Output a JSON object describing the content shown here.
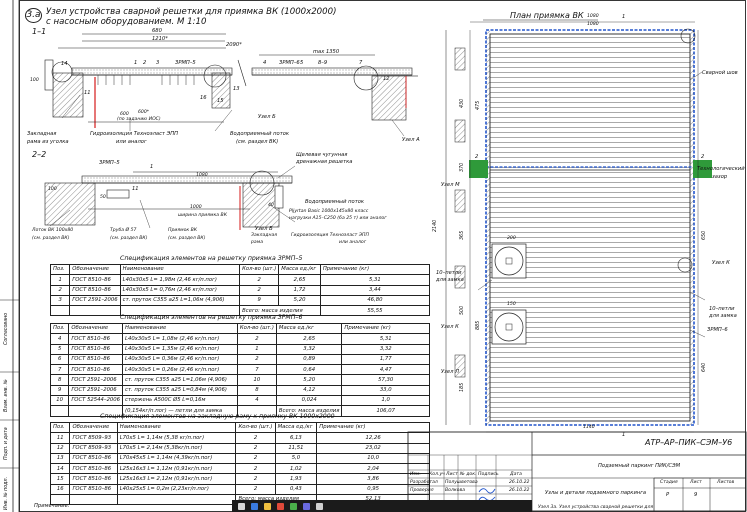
{
  "section_a": {
    "mark": "3.a",
    "title_line1": "Узел устройства сварной решетки для приямка ВК (1000х2000)",
    "title_line2": "с насосным оборудованием. М 1:10",
    "cut_1": "1–1",
    "cut_2": "2–2",
    "dims": {
      "d680": "680",
      "d2090": "2090*",
      "d1210": "1210*",
      "dmax": "max 1350",
      "d600": "600*",
      "d600b": "600",
      "d1080": "1080",
      "d1000": "1000",
      "d100a": "100",
      "d100b": "100",
      "d50": "50",
      "d40": "40"
    },
    "tags": {
      "zrmp5": "ЗРМП–5",
      "zrmp6": "ЗРМП–6",
      "t89": "8–9",
      "t14": "14",
      "t1": "1",
      "t2": "2",
      "t3": "3",
      "t4": "4",
      "t5": "5",
      "t7": "7",
      "t11": "11",
      "t12": "12",
      "t13": "13",
      "t15": "15",
      "t16": "16"
    },
    "callouts": {
      "zaklad": "Закладная",
      "rama_ugolka": "рама из уголка",
      "gidro1": "Гидроизоляция Техноэласт ЭПП",
      "po_vk1": "или аналог",
      "vodopr": "Водоприемный поток",
      "razdel": "(см. раздел ВК)",
      "uzel_b": "Узел Б",
      "uzel_a": "Узел А",
      "po_zadaniyu": "(по заданию ИОС)",
      "shchel": "Щелевая чугунная",
      "shchel2": "дренажная решетка",
      "vodopr2": "Водоприемный поток",
      "pljt1": "Pljyrtan Basic 1000х145х80 класс",
      "pljt2": "нагрузки A15–C250 (6а 25 т) или аналог",
      "lotok": "Лоток ВК 100х80",
      "lotok_r": "(см. раздел ВК)",
      "truba": "Труба Ø 57",
      "truba_r": "(см. раздел ВК)",
      "priyamok": "Приямок ВК",
      "priyamok_r": "(см. раздел ВК)",
      "shirina": "ширина приямка ВК",
      "zaklad_rama": "Закладная",
      "rama": "рама",
      "gidro2": "Гидроизоляция Техноэласт ЭПП",
      "ili": "или аналог",
      "uzel_b2": "Узел Б"
    }
  },
  "plan": {
    "title": "План приямка ВК",
    "d1080": "1080",
    "d1140": "1140",
    "d2140": "2140",
    "side_dims": [
      "430",
      "370",
      "365",
      "500",
      "185",
      "475",
      "885",
      "650",
      "640"
    ],
    "labels": {
      "svarn": "Сварной шов",
      "tech1": "Технологический",
      "tech2": "зазор",
      "uzel_k": "Узел К",
      "uzel_l": "Узел Л",
      "uzel_m": "Узел М",
      "petli1": "10–петли",
      "petli2": "для замка",
      "petli3": "10–петли",
      "petli4": "для замка",
      "zrmp6": "ЗРМП–6",
      "m1": "1",
      "m2": "2",
      "m22": "2",
      "d200": "200",
      "d150": "150"
    }
  },
  "spec5": {
    "title": "Спецификация элементов на решетку приямка ЗРМП–5",
    "headers": [
      "Поз.",
      "Обозначение",
      "Наименование",
      "Кол-во (шт.)",
      "Масса ед./кг",
      "Примечание (кг)"
    ],
    "rows": [
      [
        "1",
        "ГОСТ 8510–86",
        "L40х30х5  L= 1,98м (2,46 кг/п.пог)",
        "2",
        "2,65",
        "5,31"
      ],
      [
        "2",
        "ГОСТ 8510–86",
        "L40х30х5  L= 0,76м (2,46 кг/п.пог)",
        "2",
        "1,72",
        "3,44"
      ],
      [
        "3",
        "ГОСТ 2591–2006",
        "ст. пруток С355 а25 L=1,06м (4,906)",
        "9",
        "5,20",
        "46,80"
      ]
    ],
    "total": "Всего: масса изделия",
    "total_val": "55,55"
  },
  "spec6": {
    "title": "Спецификация элементов на решетку приямка ЗРМП–6",
    "headers": [
      "Поз.",
      "Обозначение",
      "Наименование",
      "Кол-во (шт.)",
      "Масса ед./кг",
      "Примечание (кг)"
    ],
    "rows": [
      [
        "4",
        "ГОСТ 8510–86",
        "L40х30х5  L= 1,08м (2,46 кг/п.пог)",
        "2",
        "2,65",
        "5,31"
      ],
      [
        "5",
        "ГОСТ 8510–86",
        "L40х30х5  L= 1,35м (2,46 кг/п.пог)",
        "1",
        "3,32",
        "3,32"
      ],
      [
        "6",
        "ГОСТ 8510–86",
        "L40х30х5  L= 0,36м (2,46 кг/п.пог)",
        "2",
        "0,89",
        "1,77"
      ],
      [
        "7",
        "ГОСТ 8510–86",
        "L40х30х5  L= 0,26м (2,46 кг/п.пог)",
        "7",
        "0,64",
        "4,47"
      ],
      [
        "8",
        "ГОСТ 2591–2006",
        "ст. пруток С355 а25 L=1,06м (4,906)",
        "10",
        "5,20",
        "57,30"
      ],
      [
        "9",
        "ГОСТ 2591–2006",
        "ст. пруток С355 а25 L=0,84м (4,906)",
        "8",
        "4,12",
        "33,0"
      ],
      [
        "10",
        "ГОСТ 52544–2006",
        "стержень А500С Ø5 L=0,16м",
        "4",
        "0,024",
        "1,0"
      ],
      [
        "",
        "",
        "(0,154кг/п.пог) — петли для замка",
        "",
        "Всего: масса изделия",
        "106,07"
      ]
    ]
  },
  "spec_zakl": {
    "title": "Спецификация элементов на закладную раму к приямку ВК 1000х2000",
    "headers": [
      "Поз.",
      "Обозначение",
      "Наименование",
      "Кол-во (шт.)",
      "Масса ед./кг",
      "Примечание (кг)"
    ],
    "rows": [
      [
        "11",
        "ГОСТ 8509–93",
        "L70х5  L= 1,14м (5,38 кг/п.пог)",
        "2",
        "6,13",
        "12,26"
      ],
      [
        "12",
        "ГОСТ 8509–93",
        "L70х5  L= 2,14м (5,38кг/п.пог)",
        "2",
        "11,51",
        "23,02"
      ],
      [
        "13",
        "ГОСТ 8510–86",
        "L70х45х5  L= 1,14м (4,39кг/п.пог)",
        "2",
        "5,0",
        "10,0"
      ],
      [
        "14",
        "ГОСТ 8510–86",
        "L25х16х3  L= 1,12м (0,91кг/п.пог)",
        "2",
        "1,02",
        "2,04"
      ],
      [
        "15",
        "ГОСТ 8510–86",
        "L25х16х3  L= 2,12м (0,91кг/п.пог)",
        "2",
        "1,93",
        "3,86"
      ],
      [
        "16",
        "ГОСТ 8510–86",
        "L40х25х5  L= 0,2м (2,23кг/п.пог)",
        "2",
        "0,43",
        "0,95"
      ]
    ],
    "total": "Всего: масса изделия",
    "total_val": "52,13",
    "note": "Примечание:"
  },
  "side_stamp": {
    "a": "Согласовано",
    "b": "Взам. инв. №",
    "c": "Подп. и дата",
    "d": "Инв. № подл."
  },
  "title_block": {
    "code": "АТР–АР–ПИК–СЭМ–У6",
    "project": "Подземный паркинг ПИК/СЭМ",
    "sheet_name": "Узлы и детали подземного паркинга",
    "cols": [
      "Изм.",
      "Кол.уч",
      "Лист",
      "№ док.",
      "Подпись",
      "Дата"
    ],
    "r1": [
      "Разработал",
      "Полушветова",
      "",
      "26.10.22"
    ],
    "r2": [
      "Проверил",
      "Волкова",
      "",
      "26.10.22"
    ],
    "stage_h": [
      "Стадия",
      "Лист",
      "Листов"
    ],
    "stage_v": [
      "Р",
      "9",
      ""
    ],
    "node_title": "Узел 3а. Узел устройства сварной решетки для"
  },
  "colors": {
    "line": "#1a1a1a",
    "blue": "#2255cc",
    "red": "#d41a1a",
    "green": "#2f9a3a",
    "taskbar": "#1b1b1b"
  }
}
